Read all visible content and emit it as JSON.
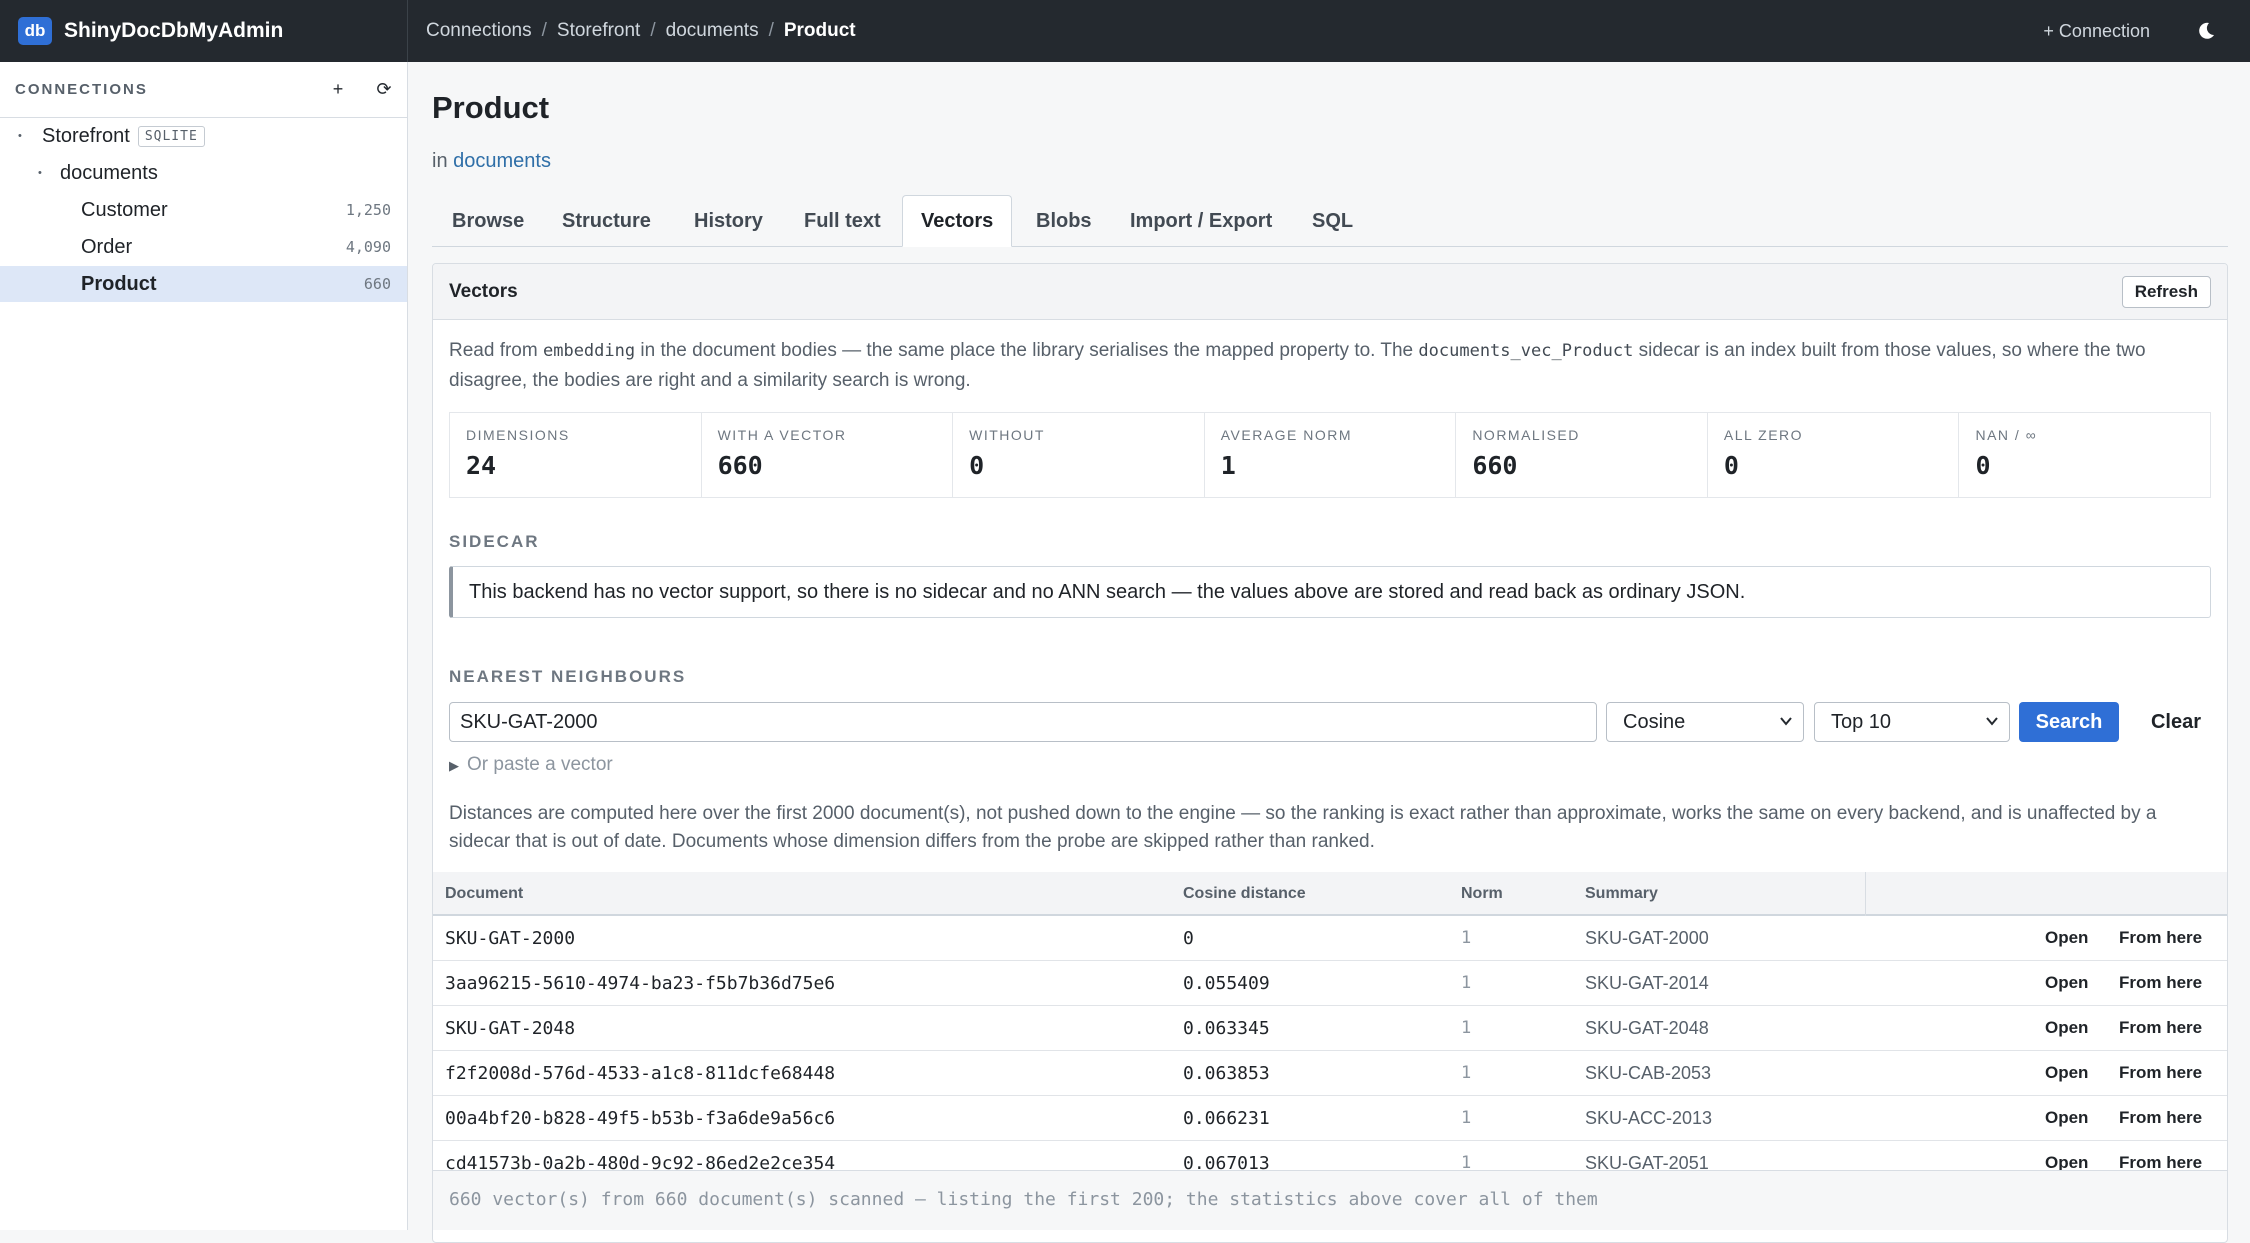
{
  "app": {
    "badge": "db",
    "name": "ShinyDocDbMyAdmin"
  },
  "breadcrumb": [
    "Connections",
    "Storefront",
    "documents",
    "Product"
  ],
  "topbar": {
    "add_connection": "+ Connection",
    "theme_icon": "moon-icon"
  },
  "sidebar": {
    "title": "CONNECTIONS",
    "add_icon": "+",
    "refresh_icon": "⟳",
    "connection": {
      "name": "Storefront",
      "tag": "SQLITE"
    },
    "database": "documents",
    "collections": [
      {
        "name": "Customer",
        "count": "1,250"
      },
      {
        "name": "Order",
        "count": "4,090"
      },
      {
        "name": "Product",
        "count": "660"
      }
    ]
  },
  "page": {
    "title": "Product",
    "sub_prefix": "in",
    "sub_link": "documents"
  },
  "tabs": [
    "Browse",
    "Structure",
    "History",
    "Full text",
    "Vectors",
    "Blobs",
    "Import / Export",
    "SQL"
  ],
  "vectors": {
    "title": "Vectors",
    "refresh": "Refresh",
    "desc_1": "Read from ",
    "desc_code_1": "embedding",
    "desc_2": " in the document bodies — the same place the library serialises the mapped property to. The ",
    "desc_code_2": "documents_vec_Product",
    "desc_3": " sidecar is an index built from those values, so where the two disagree, the bodies are right and a similarity search is wrong.",
    "stats": [
      {
        "label": "Dimensions",
        "value": "24"
      },
      {
        "label": "With a vector",
        "value": "660"
      },
      {
        "label": "Without",
        "value": "0"
      },
      {
        "label": "Average norm",
        "value": "1"
      },
      {
        "label": "Normalised",
        "value": "660"
      },
      {
        "label": "All zero",
        "value": "0"
      },
      {
        "label": "NaN / ∞",
        "value": "0"
      }
    ],
    "sidecar_label": "SIDECAR",
    "sidecar_notice": "This backend has no vector support, so there is no sidecar and no ANN search — the values above are stored and read back as ordinary JSON.",
    "nn_label": "NEAREST NEIGHBOURS",
    "nn_value": "SKU-GAT-2000",
    "metric": "Cosine",
    "top": "Top 10",
    "search": "Search",
    "clear": "Clear",
    "paste": "Or paste a vector",
    "note": "Distances are computed here over the first 2000 document(s), not pushed down to the engine — so the ranking is exact rather than approximate, works the same on every backend, and is unaffected by a sidecar that is out of date. Documents whose dimension differs from the probe are skipped rather than ranked."
  },
  "results": {
    "headers": {
      "doc": "Document",
      "dist": "Cosine distance",
      "norm": "Norm",
      "summary": "Summary"
    },
    "open": "Open",
    "from": "From here",
    "rows": [
      {
        "doc": "SKU-GAT-2000",
        "dist": "0",
        "norm": "1",
        "summary": "SKU-GAT-2000"
      },
      {
        "doc": "3aa96215-5610-4974-ba23-f5b7b36d75e6",
        "dist": "0.055409",
        "norm": "1",
        "summary": "SKU-GAT-2014"
      },
      {
        "doc": "SKU-GAT-2048",
        "dist": "0.063345",
        "norm": "1",
        "summary": "SKU-GAT-2048"
      },
      {
        "doc": "f2f2008d-576d-4533-a1c8-811dcfe68448",
        "dist": "0.063853",
        "norm": "1",
        "summary": "SKU-CAB-2053"
      },
      {
        "doc": "00a4bf20-b828-49f5-b53b-f3a6de9a56c6",
        "dist": "0.066231",
        "norm": "1",
        "summary": "SKU-ACC-2013"
      },
      {
        "doc": "cd41573b-0a2b-480d-9c92-86ed2e2ce354",
        "dist": "0.067013",
        "norm": "1",
        "summary": "SKU-GAT-2051"
      }
    ]
  },
  "footer": "660 vector(s) from 660 document(s) scanned — listing the first 200; the statistics above cover all of them"
}
